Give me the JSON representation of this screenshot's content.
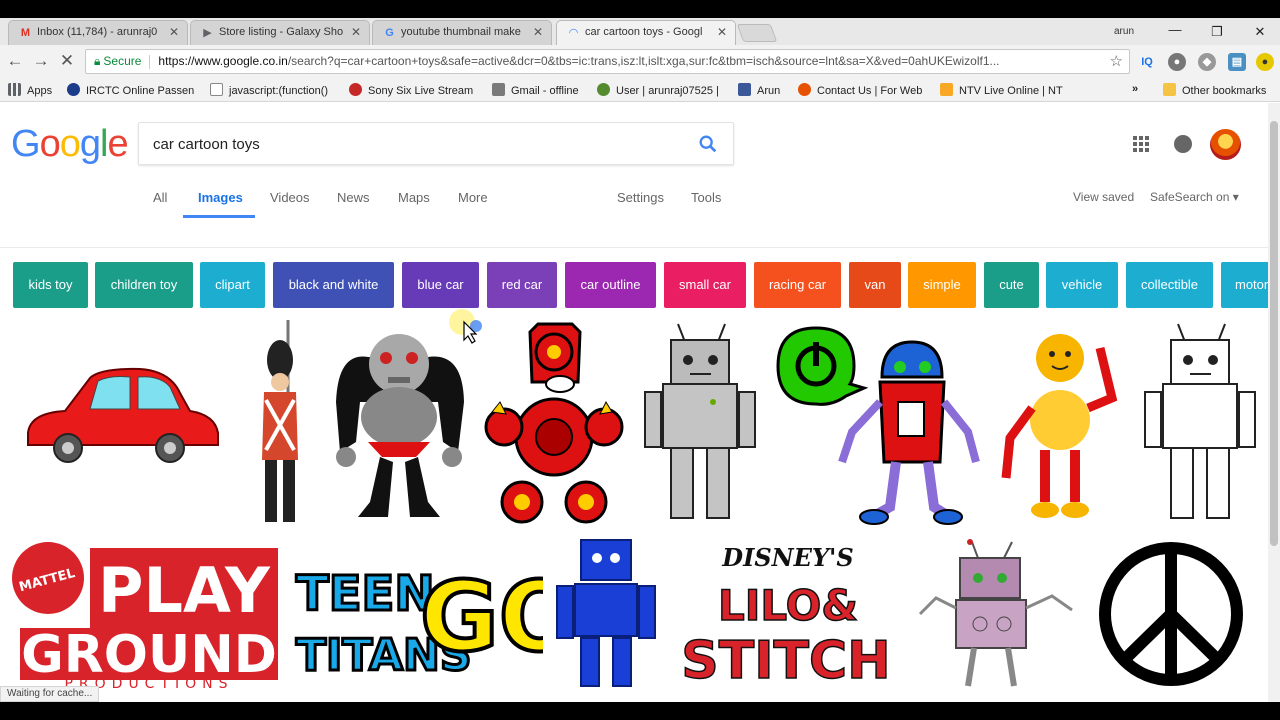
{
  "tabs": [
    {
      "label": "Inbox (11,784) - arunraj0",
      "icon": "gmail-icon",
      "color": "#d93025"
    },
    {
      "label": "Store listing - Galaxy Sho",
      "icon": "play-console-icon",
      "color": "#5f6368"
    },
    {
      "label": "youtube thumbnail make",
      "icon": "google-g-icon",
      "color": "#4285f4"
    },
    {
      "label": "car cartoon toys - Googl",
      "icon": "loading-spinner-icon",
      "color": "#4285f4"
    }
  ],
  "profile_name": "arun",
  "omnibox": {
    "secure_label": "Secure",
    "url_host": "https://www.google.co.in",
    "url_path": "/search?q=car+cartoon+toys&safe=active&dcr=0&tbs=ic:trans,isz:lt,islt:xga,sur:fc&tbm=isch&source=lnt&sa=X&ved=0ahUKEwizolf1..."
  },
  "bookmarks": [
    {
      "label": "Apps",
      "icon": "apps-grid-icon",
      "color": "#5f6368"
    },
    {
      "label": "IRCTC Online Passen",
      "icon": "irctc-icon",
      "color": "#1a3c8a"
    },
    {
      "label": "javascript:(function()",
      "icon": "page-icon",
      "color": "#888888"
    },
    {
      "label": "Sony Six Live Stream",
      "icon": "sony-six-icon",
      "color": "#c62828"
    },
    {
      "label": "Gmail - offline",
      "icon": "gmail-offline-icon",
      "color": "#7a7a7a"
    },
    {
      "label": "User | arunraj07525 |",
      "icon": "user-leaf-icon",
      "color": "#558b2f"
    },
    {
      "label": "Arun",
      "icon": "facebook-icon",
      "color": "#3b5998"
    },
    {
      "label": "Contact Us | For Web",
      "icon": "contact-icon",
      "color": "#e65100"
    },
    {
      "label": "NTV Live Online | NT",
      "icon": "ntv-icon",
      "color": "#f9a825"
    }
  ],
  "bookmarks_more": "»",
  "other_bookmarks": "Other bookmarks",
  "search": {
    "query": "car cartoon toys"
  },
  "nav_tabs": [
    "All",
    "Images",
    "Videos",
    "News",
    "Maps",
    "More"
  ],
  "settings_label": "Settings",
  "tools_label": "Tools",
  "view_saved_label": "View saved",
  "safesearch_label": "SafeSearch on ▾",
  "chips": [
    {
      "label": "kids toy",
      "color": "#1a9e8a"
    },
    {
      "label": "children toy",
      "color": "#1a9e8a"
    },
    {
      "label": "clipart",
      "color": "#1cadd1"
    },
    {
      "label": "black and white",
      "color": "#3f51b5"
    },
    {
      "label": "blue car",
      "color": "#673ab7"
    },
    {
      "label": "red car",
      "color": "#7b40b8"
    },
    {
      "label": "car outline",
      "color": "#9c27b0"
    },
    {
      "label": "small car",
      "color": "#e91e63"
    },
    {
      "label": "racing car",
      "color": "#f4511e"
    },
    {
      "label": "van",
      "color": "#e64a19"
    },
    {
      "label": "simple",
      "color": "#ff9800"
    },
    {
      "label": "cute",
      "color": "#1a9e8a"
    },
    {
      "label": "vehicle",
      "color": "#1cadd1"
    },
    {
      "label": "collectible",
      "color": "#1cadd1"
    },
    {
      "label": "motor",
      "color": "#1cadd1"
    }
  ],
  "results": [
    {
      "name": "red-car-image"
    },
    {
      "name": "toy-soldier-image"
    },
    {
      "name": "grey-robot-image"
    },
    {
      "name": "red-robot-image"
    },
    {
      "name": "silver-robot-image"
    },
    {
      "name": "blue-robot-power-image"
    },
    {
      "name": "yellow-robot-image"
    },
    {
      "name": "outline-robot-image"
    },
    {
      "name": "mattel-playground-image",
      "text": {
        "brand": "MATTEL",
        "line1": "PLAY",
        "line2": "GROUND",
        "line3": "PRODUCTIONS"
      }
    },
    {
      "name": "teen-titans-go-image",
      "text": {
        "line1": "TEEN",
        "line2": "TITANS",
        "go": "GO!"
      }
    },
    {
      "name": "blue-block-robot-image"
    },
    {
      "name": "lilo-stitch-image",
      "text": {
        "brand": "DISNEY'S",
        "line1": "LILO&",
        "line2": "STITCH"
      }
    },
    {
      "name": "pink-robot-image"
    },
    {
      "name": "peace-sign-image"
    }
  ],
  "status_text": "Waiting for cache..."
}
